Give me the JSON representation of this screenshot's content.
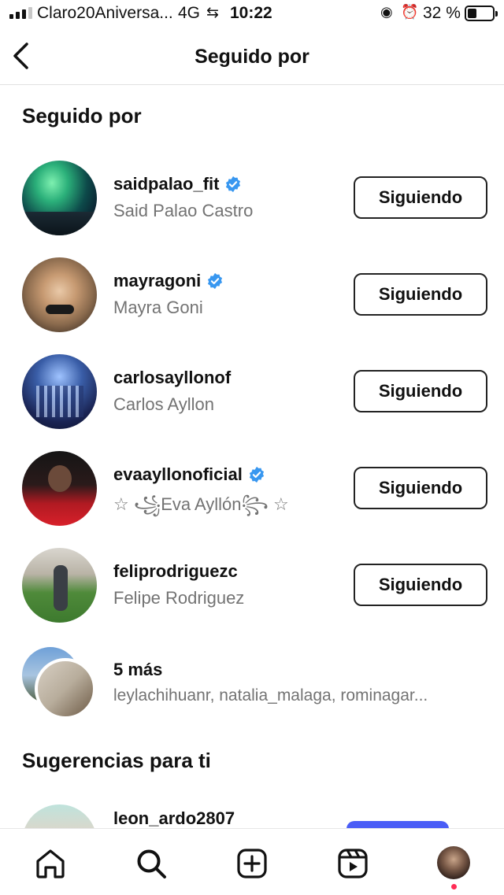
{
  "status_bar": {
    "carrier": "Claro20Aniversa...",
    "network": "4G",
    "time": "10:22",
    "battery": "32 %"
  },
  "header": {
    "title": "Seguido por"
  },
  "followed_by": {
    "section_title": "Seguido por",
    "users": [
      {
        "username": "saidpalao_fit",
        "full_name": "Said Palao Castro",
        "verified": true,
        "button": "Siguiendo"
      },
      {
        "username": "mayragoni",
        "full_name": "Mayra Goni",
        "verified": true,
        "button": "Siguiendo"
      },
      {
        "username": "carlosayllonof",
        "full_name": "Carlos Ayllon",
        "verified": false,
        "button": "Siguiendo"
      },
      {
        "username": "evaayllonoficial",
        "full_name": "☆ ꧁Eva Ayllón꧂ ☆",
        "verified": true,
        "button": "Siguiendo"
      },
      {
        "username": "feliprodriguezc",
        "full_name": "Felipe Rodriguez",
        "verified": false,
        "button": "Siguiendo"
      }
    ],
    "more": {
      "title": "5 más",
      "names": "leylachihuanr, natalia_malaga, rominagar..."
    }
  },
  "suggestions": {
    "section_title": "Sugerencias para ti",
    "first_username": "leon_ardo2807"
  },
  "colors": {
    "verified_badge": "#3897f0",
    "follow_button_border": "#222222",
    "suggest_button": "#4a5df6",
    "notification_dot": "#ff2c55",
    "secondary_text": "#737373"
  },
  "tabbar": {
    "icons": [
      "home-icon",
      "search-icon",
      "create-icon",
      "reels-icon",
      "profile-avatar"
    ]
  }
}
